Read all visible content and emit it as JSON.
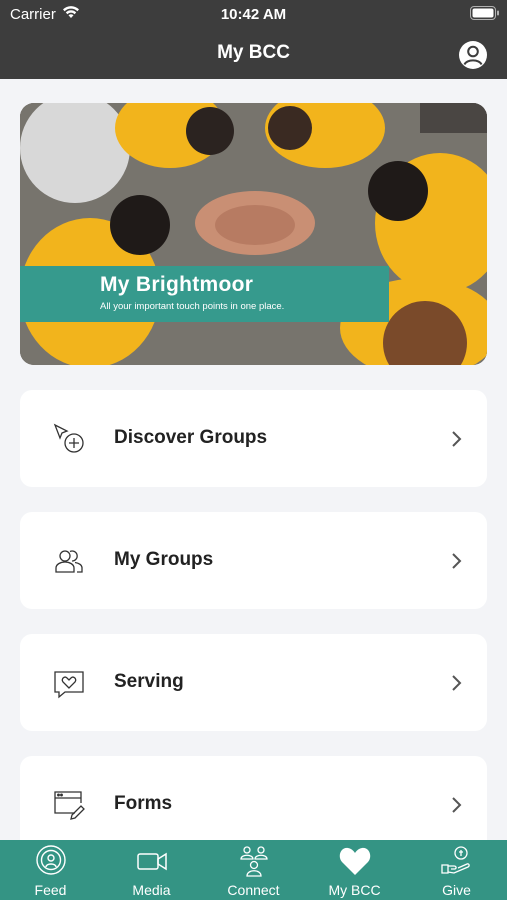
{
  "status_bar": {
    "carrier": "Carrier",
    "time": "10:42 AM"
  },
  "header": {
    "title": "My BCC",
    "profile_icon": "profile-icon"
  },
  "banner": {
    "title": "My Brightmoor",
    "subtitle": "All your important touch points in one place.",
    "caption_color": "#369a8d"
  },
  "cards": [
    {
      "label": "Discover Groups",
      "icon": "discover-groups-icon"
    },
    {
      "label": "My Groups",
      "icon": "my-groups-icon"
    },
    {
      "label": "Serving",
      "icon": "serving-icon"
    },
    {
      "label": "Forms",
      "icon": "forms-icon"
    }
  ],
  "tabbar": {
    "color": "#349484",
    "tabs": [
      {
        "label": "Feed",
        "icon": "feed-icon"
      },
      {
        "label": "Media",
        "icon": "media-icon"
      },
      {
        "label": "Connect",
        "icon": "connect-icon"
      },
      {
        "label": "My BCC",
        "icon": "heart-icon",
        "active": true
      },
      {
        "label": "Give",
        "icon": "give-icon"
      }
    ]
  }
}
